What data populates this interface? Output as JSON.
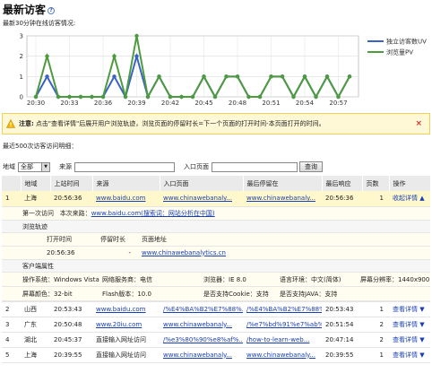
{
  "header": {
    "title": "最新访客",
    "subtitle": "最新30分钟在线访客情况:"
  },
  "colors": {
    "uv": "#3b63c4",
    "pv": "#4e9a3e",
    "notice_bg": "#fff8d6",
    "highlight": "#fff8cc"
  },
  "chart_data": {
    "type": "line",
    "x": [
      "20:30",
      "20:31",
      "20:32",
      "20:33",
      "20:34",
      "20:35",
      "20:36",
      "20:37",
      "20:38",
      "20:39",
      "20:40",
      "20:41",
      "20:42",
      "20:43",
      "20:44",
      "20:45",
      "20:46",
      "20:47",
      "20:48",
      "20:49",
      "20:50",
      "20:51",
      "20:52",
      "20:53",
      "20:54",
      "20:55",
      "20:56",
      "20:57",
      "20:58"
    ],
    "xticks": [
      "20:30",
      "20:33",
      "20:36",
      "20:39",
      "20:42",
      "20:45",
      "20:48",
      "20:51",
      "20:54",
      "20:57"
    ],
    "ylim": [
      0,
      3
    ],
    "yticks": [
      "0",
      "1",
      "2",
      "3"
    ],
    "series": [
      {
        "name": "独立访客数UV",
        "values": [
          0,
          1,
          0,
          0,
          0,
          0,
          0,
          1,
          0,
          2,
          0,
          1,
          0,
          0,
          0,
          1,
          0,
          1,
          1,
          0,
          0,
          1,
          1,
          0,
          1,
          0,
          1,
          0,
          1
        ]
      },
      {
        "name": "浏览量PV",
        "values": [
          0,
          2,
          0,
          0,
          0,
          0,
          0,
          2,
          0,
          3,
          0,
          1,
          0,
          0,
          0,
          1,
          0,
          1,
          1,
          0,
          0,
          1,
          1,
          0,
          1,
          0,
          1,
          0,
          1
        ]
      }
    ]
  },
  "notice": {
    "label": "注意:",
    "text": "点击\"查看详情\"后展开用户浏览轨迹，浏览页面的停留时长=下一个页面的打开时间-本页面打开的时间。",
    "close": "×"
  },
  "recent_label": "最近500次访客访问明细：",
  "filter": {
    "region_label": "地域",
    "region_value": "全部",
    "source_label": "来源",
    "entry_label": "入口页面",
    "query_button": "查询"
  },
  "table": {
    "headers": [
      "",
      "地域",
      "上站时间",
      "来源",
      "入口页面",
      "最后停留在",
      "最后响应",
      "页数",
      "操作"
    ],
    "rows": [
      {
        "n": "1",
        "region": "上海",
        "time": "20:56:36",
        "source": "www.baidu.com",
        "entry": "www.chinawebanaly...",
        "last": "www.chinawebanaly...",
        "resp": "20:56:36",
        "pages": "1",
        "op": "收起详情 ▲"
      },
      {
        "n": "2",
        "region": "山西",
        "time": "20:53:43",
        "source": "www.baidu.com",
        "entry": "/%E4%BA%B2%E7%88%...",
        "last": "/%E4%BA%B2%E7%88%...",
        "resp": "20:53:43",
        "pages": "1",
        "op": "查看详情 ▼"
      },
      {
        "n": "3",
        "region": "广东",
        "time": "20:50:48",
        "source": "www.20iu.com",
        "entry": "www.chinawebanaly...",
        "last": "/%e7%bd%91%e7%ab%...",
        "resp": "20:51:54",
        "pages": "2",
        "op": "查看详情 ▼"
      },
      {
        "n": "4",
        "region": "湖北",
        "time": "20:45:37",
        "source": "直接输入网址访问",
        "entry": "/%e3%80%90%e8%af%...",
        "last": "/how-to-learn-web...",
        "resp": "20:47:14",
        "pages": "2",
        "op": "查看详情 ▼"
      },
      {
        "n": "5",
        "region": "上海",
        "time": "20:39:55",
        "source": "直接输入网址访问",
        "entry": "www.chinawebanaly...",
        "last": "www.chinawebanaly...",
        "resp": "20:39:55",
        "pages": "1",
        "op": "查看详情 ▼"
      }
    ]
  },
  "detail": {
    "first_visit": "第一次访问",
    "source_label": "本次来路：",
    "source_link": "www.baidu.com(搜索词：网站分析在中国)",
    "trail_label": "浏览轨迹",
    "trail_headers": [
      "打开时间",
      "停留时长",
      "页面地址"
    ],
    "trail_row": {
      "time": "20:56:36",
      "stay": "-",
      "url": "www.chinawebanalytics.cn"
    },
    "client_label": "客户端属性",
    "attrs1": [
      "操作系统：Windows Vista",
      "网络服务商：电信",
      "浏览器：IE 8.0",
      "语言环境：中文(简体)",
      "屏幕分辨率：1440x900"
    ],
    "attrs2": [
      "屏幕颜色：32-bit",
      "Flash版本：10.0",
      "是否支持Cookie：支持",
      "是否支持JAVA：支持"
    ]
  }
}
